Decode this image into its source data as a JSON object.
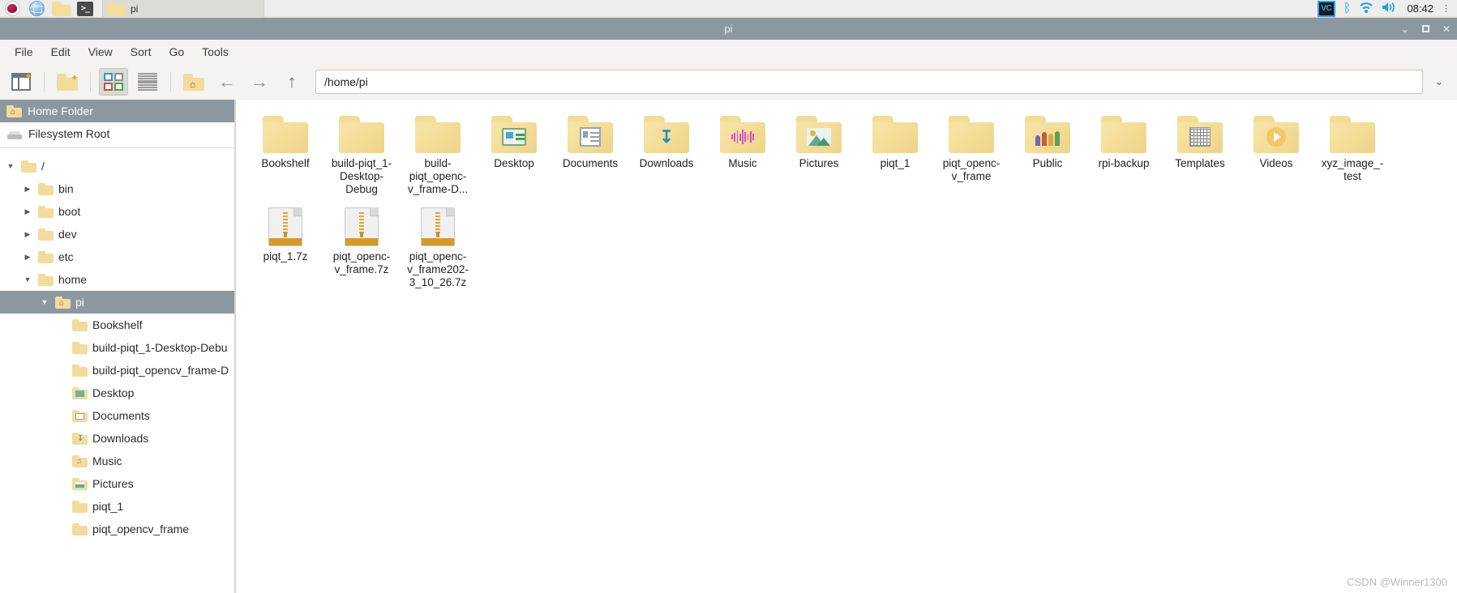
{
  "taskbar": {
    "launchers": [
      {
        "name": "raspberry-menu-icon",
        "label": "Raspberry Pi Menu"
      },
      {
        "name": "web-browser-icon",
        "label": "Web Browser"
      },
      {
        "name": "file-manager-icon",
        "label": "File Manager"
      },
      {
        "name": "terminal-icon",
        "label": ">_"
      }
    ],
    "window_button": "pi",
    "tray": {
      "vnc_label": "VC",
      "bluetooth_glyph": "ᛒ",
      "wifi_glyph": "◞",
      "volume_glyph": "🔊",
      "clock": "08:42"
    }
  },
  "window": {
    "title": "pi",
    "controls": {
      "minimize": "⌄",
      "maximize": "□",
      "close": "✕"
    }
  },
  "menubar": {
    "items": [
      "File",
      "Edit",
      "View",
      "Sort",
      "Go",
      "Tools"
    ]
  },
  "toolbar": {
    "new_tab": "new-tab",
    "new_folder": "new-folder",
    "icon_view": "icon-view",
    "list_view": "list-view",
    "home": "home-folder",
    "back": "←",
    "forward": "→",
    "up": "↑",
    "dropdown": "⌄"
  },
  "path": {
    "value": "/home/pi",
    "placeholder": "/home/pi"
  },
  "sidebar": {
    "places": [
      {
        "label": "Home Folder",
        "icon": "home-folder-icon",
        "selected": true
      },
      {
        "label": "Filesystem Root",
        "icon": "drive-icon",
        "selected": false
      }
    ],
    "tree": [
      {
        "label": "/",
        "indent": 0,
        "twisty": "▼",
        "icon": "folder-icon",
        "selected": false
      },
      {
        "label": "bin",
        "indent": 1,
        "twisty": "▶",
        "icon": "folder-icon",
        "selected": false
      },
      {
        "label": "boot",
        "indent": 1,
        "twisty": "▶",
        "icon": "folder-icon",
        "selected": false
      },
      {
        "label": "dev",
        "indent": 1,
        "twisty": "▶",
        "icon": "folder-icon",
        "selected": false
      },
      {
        "label": "etc",
        "indent": 1,
        "twisty": "▶",
        "icon": "folder-icon",
        "selected": false
      },
      {
        "label": "home",
        "indent": 1,
        "twisty": "▼",
        "icon": "folder-icon",
        "selected": false
      },
      {
        "label": "pi",
        "indent": 2,
        "twisty": "▼",
        "icon": "home-folder-icon",
        "selected": true
      },
      {
        "label": "Bookshelf",
        "indent": 3,
        "twisty": "",
        "icon": "folder-icon",
        "selected": false
      },
      {
        "label": "build-piqt_1-Desktop-Debu",
        "indent": 3,
        "twisty": "",
        "icon": "folder-icon",
        "selected": false
      },
      {
        "label": "build-piqt_opencv_frame-D",
        "indent": 3,
        "twisty": "",
        "icon": "folder-icon",
        "selected": false
      },
      {
        "label": "Desktop",
        "indent": 3,
        "twisty": "",
        "icon": "desktop-folder-icon",
        "selected": false
      },
      {
        "label": "Documents",
        "indent": 3,
        "twisty": "",
        "icon": "documents-folder-icon",
        "selected": false
      },
      {
        "label": "Downloads",
        "indent": 3,
        "twisty": "",
        "icon": "downloads-folder-icon",
        "selected": false
      },
      {
        "label": "Music",
        "indent": 3,
        "twisty": "",
        "icon": "music-folder-icon",
        "selected": false
      },
      {
        "label": "Pictures",
        "indent": 3,
        "twisty": "",
        "icon": "pictures-folder-icon",
        "selected": false
      },
      {
        "label": "piqt_1",
        "indent": 3,
        "twisty": "",
        "icon": "folder-icon",
        "selected": false
      },
      {
        "label": "piqt_opencv_frame",
        "indent": 3,
        "twisty": "",
        "icon": "folder-icon",
        "selected": false
      }
    ]
  },
  "files": [
    {
      "name": "Bookshelf",
      "kind": "folder",
      "emblem": "none"
    },
    {
      "name": "build-piqt_1-\nDesktop-\nDebug",
      "kind": "folder",
      "emblem": "none"
    },
    {
      "name": "build-\npiqt_openc-\nv_frame-D...",
      "kind": "folder",
      "emblem": "none"
    },
    {
      "name": "Desktop",
      "kind": "folder",
      "emblem": "desktop"
    },
    {
      "name": "Documents",
      "kind": "folder",
      "emblem": "doc"
    },
    {
      "name": "Downloads",
      "kind": "folder",
      "emblem": "down"
    },
    {
      "name": "Music",
      "kind": "folder",
      "emblem": "music"
    },
    {
      "name": "Pictures",
      "kind": "folder",
      "emblem": "pic"
    },
    {
      "name": "piqt_1",
      "kind": "folder",
      "emblem": "none"
    },
    {
      "name": "piqt_openc-\nv_frame",
      "kind": "folder",
      "emblem": "none"
    },
    {
      "name": "Public",
      "kind": "folder",
      "emblem": "public"
    },
    {
      "name": "rpi-backup",
      "kind": "folder",
      "emblem": "none"
    },
    {
      "name": "Templates",
      "kind": "folder",
      "emblem": "templ"
    },
    {
      "name": "Videos",
      "kind": "folder",
      "emblem": "video"
    },
    {
      "name": "xyz_image_-\ntest",
      "kind": "folder",
      "emblem": "none"
    },
    {
      "name": "piqt_1.7z",
      "kind": "archive",
      "emblem": "none"
    },
    {
      "name": "piqt_openc-\nv_frame.7z",
      "kind": "archive",
      "emblem": "none"
    },
    {
      "name": "piqt_openc-\nv_frame202-\n3_10_26.7z",
      "kind": "archive",
      "emblem": "none"
    }
  ],
  "watermark": "CSDN @Winner1300",
  "colors": {
    "titlebar": "#8b98a0",
    "folder": "#f3dc95",
    "accent": "#1c9fe8",
    "archive_band": "#d79a26"
  }
}
